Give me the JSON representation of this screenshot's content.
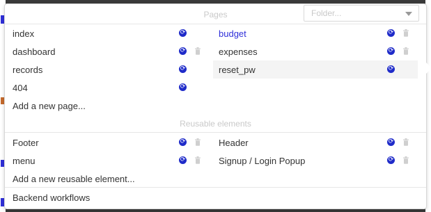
{
  "pages_section": {
    "title": "Pages",
    "folder_placeholder": "Folder...",
    "left": [
      {
        "label": "index",
        "sync": true,
        "trash": false
      },
      {
        "label": "dashboard",
        "sync": true,
        "trash": true
      },
      {
        "label": "records",
        "sync": true,
        "trash": false
      },
      {
        "label": "404",
        "sync": true,
        "trash": false
      }
    ],
    "right": [
      {
        "label": "budget",
        "sync": true,
        "trash": true,
        "active": true
      },
      {
        "label": "expenses",
        "sync": true,
        "trash": true
      },
      {
        "label": "reset_pw",
        "sync": true,
        "trash": false,
        "hovered": true
      }
    ],
    "add_label": "Add a new page..."
  },
  "reusable_section": {
    "title": "Reusable elements",
    "left": [
      {
        "label": "Footer",
        "sync": true,
        "trash": true
      },
      {
        "label": "menu",
        "sync": true,
        "trash": true
      }
    ],
    "right": [
      {
        "label": "Header",
        "sync": true,
        "trash": true
      },
      {
        "label": "Signup / Login Popup",
        "sync": true,
        "trash": true
      }
    ],
    "add_label": "Add a new reusable element..."
  },
  "backend_label": "Backend workflows",
  "colors": {
    "accent": "#2f2fd9",
    "sync_icon": "#1f2bc9",
    "muted": "#c9c9c9"
  }
}
